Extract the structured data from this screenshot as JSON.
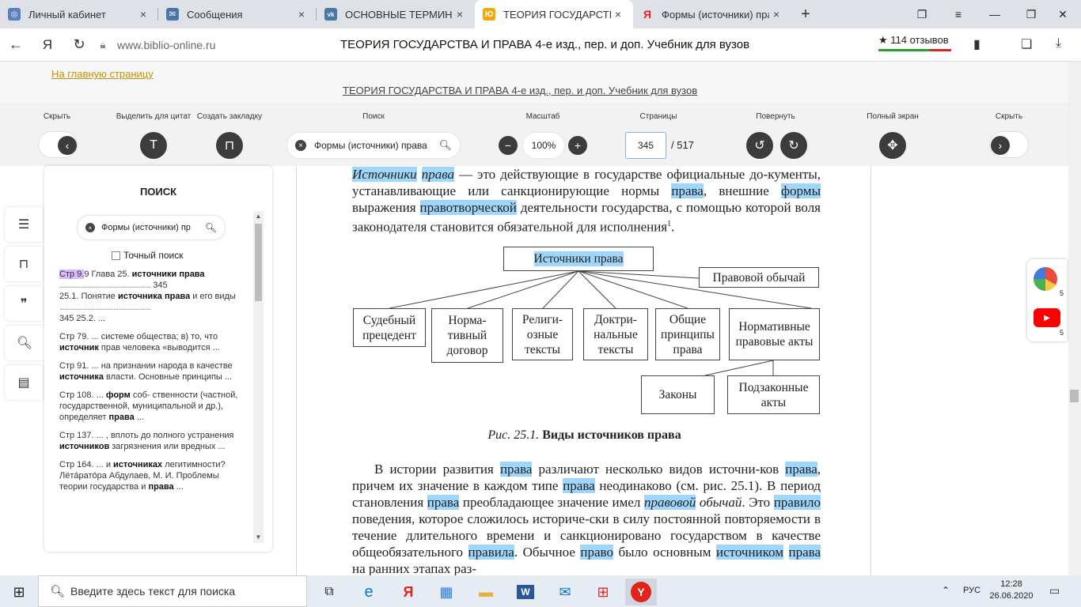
{
  "tabs": [
    {
      "title": "Личный кабинет",
      "color": "#5b7fbf",
      "glyph": "◎"
    },
    {
      "title": "Сообщения",
      "color": "#4a76a8",
      "glyph": "✉"
    },
    {
      "title": "ОСНОВНЫЕ ТЕРМИНЫ ПО",
      "color": "#4a76a8",
      "glyph": "vk"
    },
    {
      "title": "ТЕОРИЯ ГОСУДАРСТВА",
      "color": "#f2a80f",
      "glyph": "Ю"
    },
    {
      "title": "Формы (источники) права",
      "color": "#ffffff",
      "glyph": "Я"
    }
  ],
  "address": {
    "url": "www.biblio-online.ru",
    "page_title": "ТЕОРИЯ ГОСУДАРСТВА И ПРАВА 4-е изд., пер. и доп. Учебник для вузов",
    "reviews": "★ 114 отзывов"
  },
  "header": {
    "home_link": "На главную страницу",
    "book_link": "ТЕОРИЯ ГОСУДАРСТВА И ПРАВА 4-е изд., пер. и доп. Учебник для вузов"
  },
  "toolbar": {
    "hide_left": "Скрыть",
    "quote": "Выделить для цитат",
    "bookmark": "Создать закладку",
    "search": "Поиск",
    "scale": "Масштаб",
    "pages": "Страницы",
    "rotate": "Повернуть",
    "fullscreen": "Полный экран",
    "hide_right": "Скрыть",
    "search_value": "Формы (источники) права",
    "zoom_value": "100%",
    "page_value": "345",
    "page_total": "/ 517"
  },
  "panel": {
    "title": "ПОИСК",
    "search_value": "Формы (источники) пр",
    "exact_label": "Точный поиск"
  },
  "document": {
    "fig_boxes": {
      "sources": "Источники права",
      "custom": "Правовой обычай",
      "precedent": "Судебный прецедент",
      "contract": "Норма-тивный договор",
      "religious": "Религи-озные тексты",
      "doctrinal": "Доктри-нальные тексты",
      "principles": "Общие принципы права",
      "acts": "Нормативные правовые акты",
      "laws": "Законы",
      "bylaws": "Подзаконные акты"
    },
    "caption_prefix": "Рис. 25.1.",
    "caption_text": "Виды источников права"
  },
  "taskbar": {
    "search_placeholder": "Введите здесь текст для поиска",
    "lang": "РУС",
    "time": "12:28",
    "date": "26.06.2020"
  },
  "widgets": {
    "badge1": "5",
    "badge2": "5"
  }
}
